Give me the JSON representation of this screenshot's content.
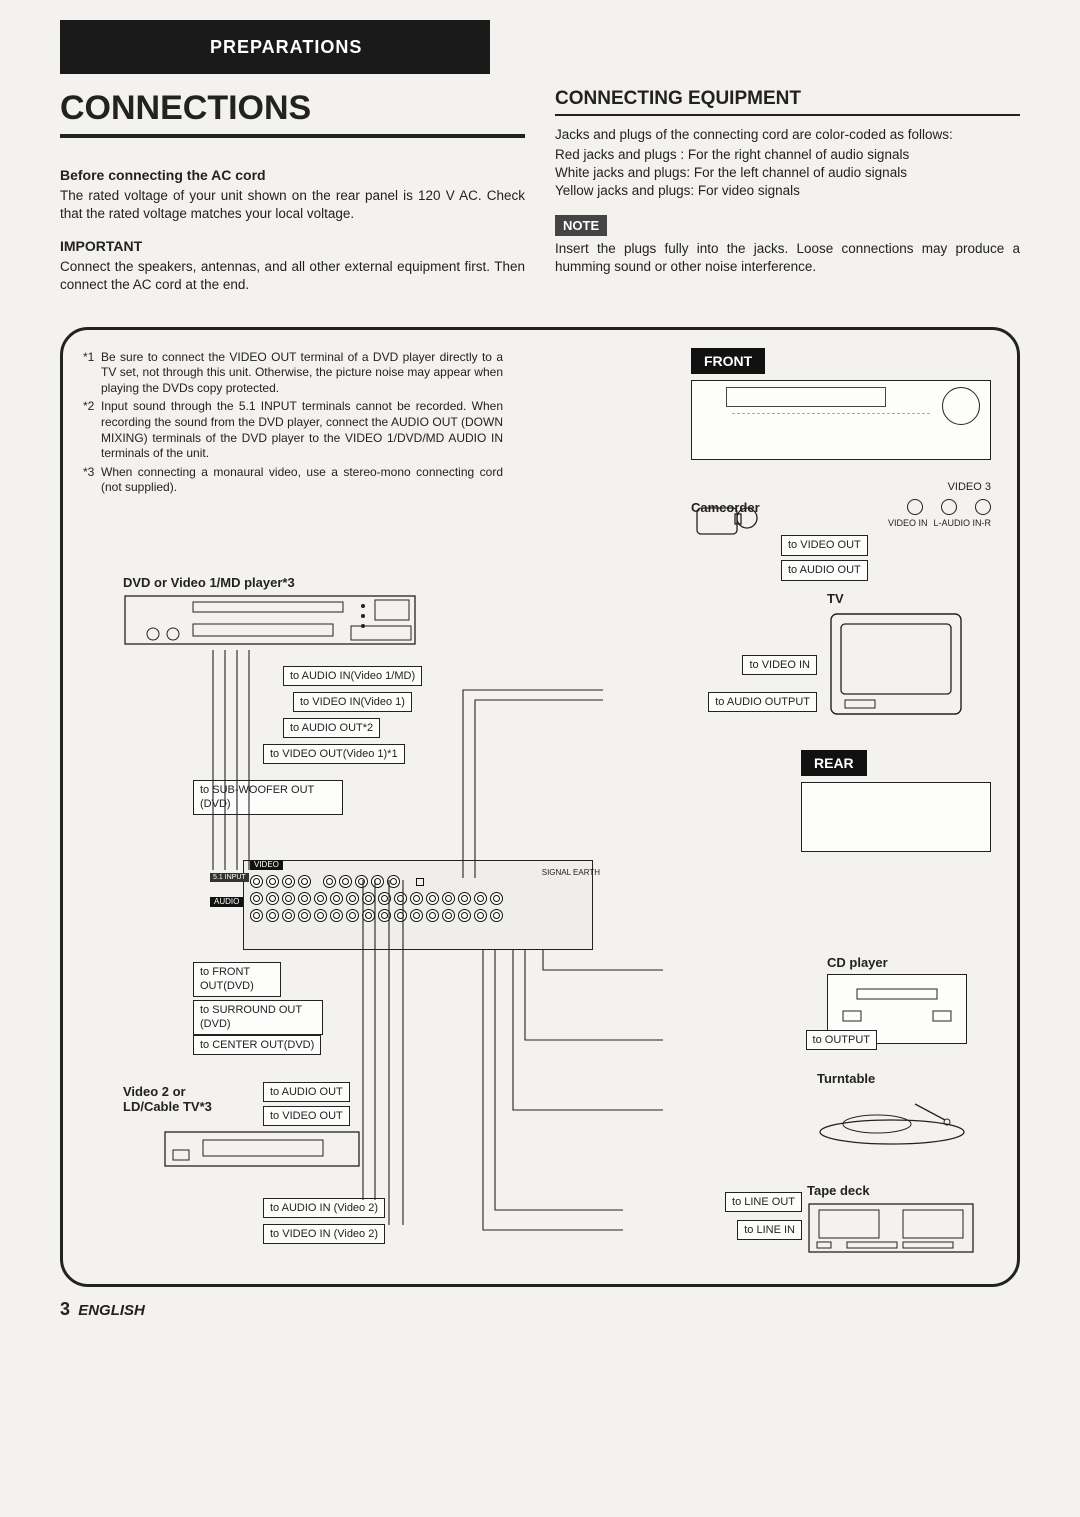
{
  "topbar": {
    "label": "PREPARATIONS"
  },
  "left": {
    "title": "CONNECTIONS",
    "h1": "Before connecting the AC cord",
    "p1": "The rated voltage of your unit shown on the rear panel is 120 V AC. Check that the rated voltage matches your local voltage.",
    "h2": "IMPORTANT",
    "p2": "Connect the speakers, antennas, and all other external equipment first. Then connect the AC cord at the end."
  },
  "right": {
    "title": "CONNECTING EQUIPMENT",
    "p1": "Jacks and plugs of the connecting cord are color-coded as follows:",
    "l1": "Red jacks and plugs : For the right channel of audio signals",
    "l2": "White jacks and plugs: For the left channel of audio signals",
    "l3": "Yellow jacks and plugs: For video signals",
    "note_label": "NOTE",
    "note_text": "Insert the plugs fully into the jacks. Loose connections may produce a humming sound or other noise interference."
  },
  "footnotes": {
    "m1": "*1",
    "t1": "Be sure to connect the VIDEO OUT terminal of a DVD player directly to a TV set, not through this unit. Otherwise, the picture noise may appear when playing the DVDs copy protected.",
    "m2": "*2",
    "t2": "Input sound through the 5.1 INPUT terminals cannot be recorded. When recording the sound from the DVD player, connect the AUDIO OUT (DOWN MIXING) terminals of the DVD player to the VIDEO 1/DVD/MD AUDIO IN terminals of the unit.",
    "m3": "*3",
    "t3": "When connecting a monaural video, use a stereo-mono connecting cord (not supplied)."
  },
  "diagram": {
    "front_label": "FRONT",
    "rear_label": "REAR",
    "camcorder": "Camcorder",
    "video3": "VIDEO 3",
    "video_in_label": "VIDEO IN",
    "audio_in_lr": "L-AUDIO IN-R",
    "to_video_out": "to VIDEO OUT",
    "to_audio_out": "to AUDIO OUT",
    "dvd_caption": "DVD or Video 1/MD player*3",
    "tv_caption": "TV",
    "to_video_in": "to VIDEO IN",
    "to_audio_output": "to AUDIO OUTPUT",
    "to_audio_in_v1": "to AUDIO IN(Video 1/MD)",
    "to_video_in_v1": "to VIDEO IN(Video 1)",
    "to_audio_out_2": "to AUDIO OUT*2",
    "to_video_out_v1": "to VIDEO OUT(Video 1)*1",
    "to_sub_out": "to SUB-WOOFER OUT (DVD)",
    "to_front_out": "to FRONT OUT(DVD)",
    "to_surround_out": "to SURROUND OUT (DVD)",
    "to_center_out": "to CENTER OUT(DVD)",
    "video2_caption": "Video 2 or LD/Cable TV*3",
    "to_audio_out_b": "to AUDIO OUT",
    "to_video_out_b": "to VIDEO OUT",
    "to_audio_in_v2": "to AUDIO IN (Video 2)",
    "to_video_in_v2": "to VIDEO IN (Video 2)",
    "cd_caption": "CD player",
    "to_output": "to OUTPUT",
    "turntable_caption": "Turntable",
    "tape_caption": "Tape deck",
    "to_line_out": "to LINE OUT",
    "to_line_in": "to LINE IN",
    "rear_labels": {
      "video": "VIDEO",
      "audio": "AUDIO",
      "input51": "5.1 INPUT",
      "signal_earth": "SIGNAL EARTH"
    }
  },
  "footer": {
    "page": "3",
    "lang": "ENGLISH"
  }
}
